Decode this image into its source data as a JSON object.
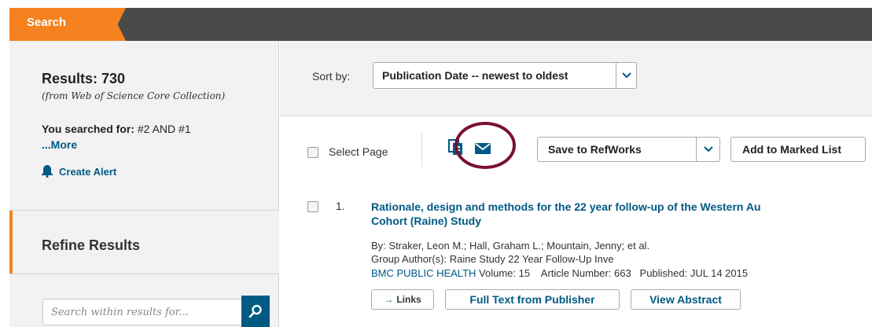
{
  "topbar": {
    "search_tab": "Search"
  },
  "sidebar": {
    "results_title": "Results: 730",
    "results_sub": "(from Web of Science Core Collection)",
    "searched_label": "You searched for:",
    "searched_query": "#2 AND #1",
    "more_link": "...More",
    "create_alert": "Create Alert",
    "refine_title": "Refine Results",
    "search_within_placeholder": "Search within results for..."
  },
  "sortbar": {
    "label": "Sort by:",
    "selected": "Publication Date -- newest to oldest"
  },
  "toolbar": {
    "select_page": "Select Page",
    "save_to": "Save to RefWorks",
    "add_marked": "Add to Marked List"
  },
  "record": {
    "number": "1.",
    "title_line1": "Rationale, design and methods for the 22 year follow-up of the Western Au",
    "title_line2": "Cohort (Raine) Study",
    "authors": "By: Straker, Leon M.; Hall, Graham L.; Mountain, Jenny; et al.",
    "group_author": "Group Author(s): Raine Study 22 Year Follow-Up Inve",
    "journal": "BMC PUBLIC HEALTH",
    "journal_rest": "Volume: 15    Article Number: 663   Published: JUL 14 2015",
    "links_btn": "Links",
    "fulltext_btn": "Full Text from Publisher",
    "abstract_btn": "View Abstract"
  },
  "icons": [
    "bell-icon",
    "search-icon",
    "chevron-down-icon",
    "print-icon",
    "email-icon",
    "arrow-right-icon"
  ],
  "colors": {
    "accent_orange": "#f5821f",
    "link_blue": "#005a84",
    "highlight_circle": "#7b1030",
    "topbar_dark": "#4a4a4a"
  }
}
